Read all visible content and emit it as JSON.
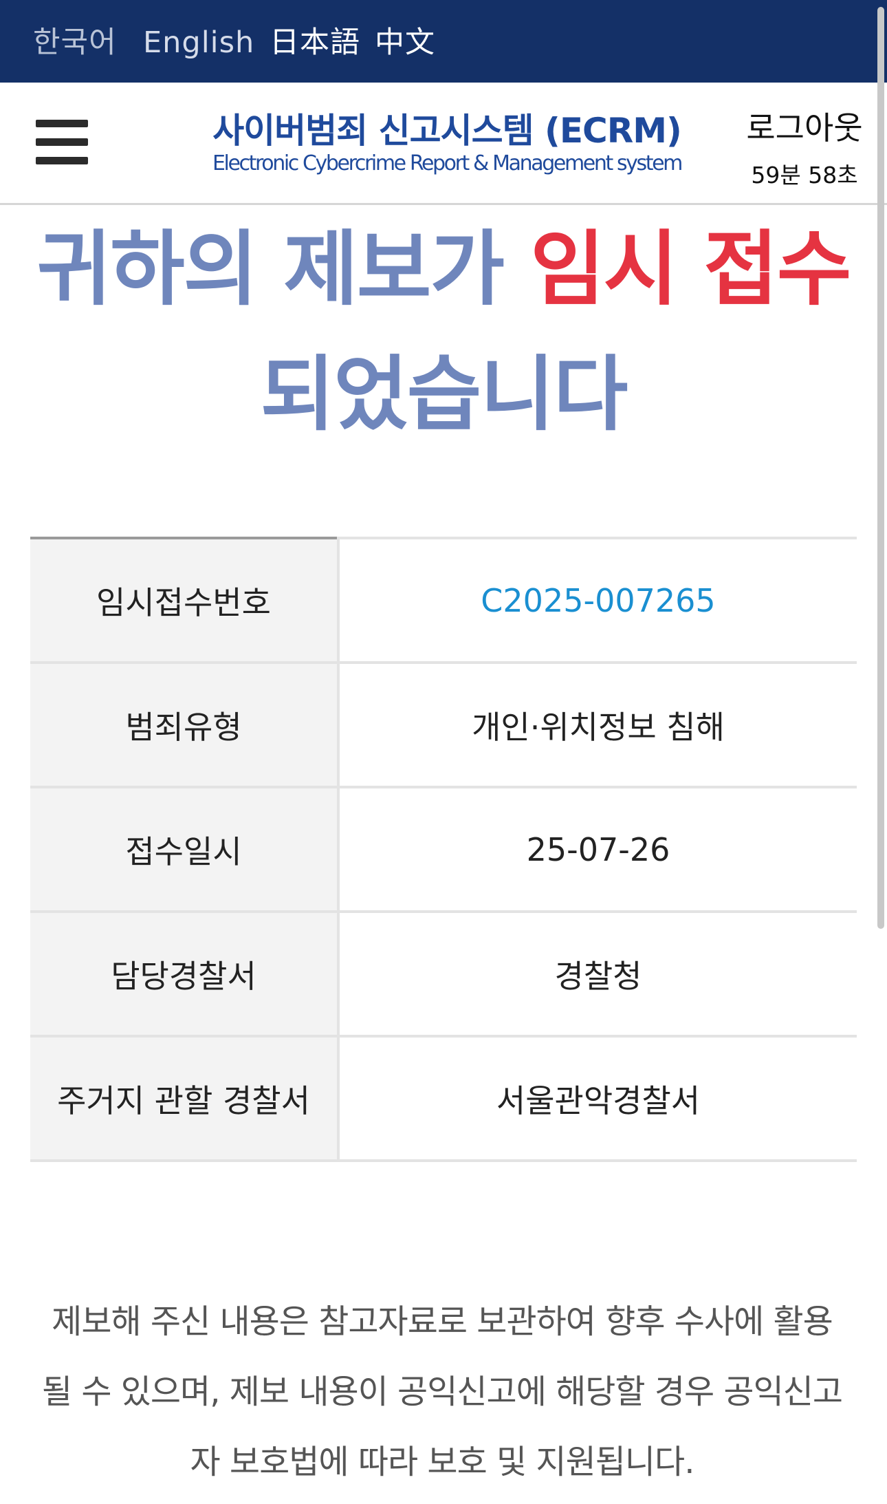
{
  "languages": [
    {
      "label": "한국어",
      "color": "#b9c3d6"
    },
    {
      "label": "English",
      "color": "#d6dcea"
    },
    {
      "label": "日本語",
      "color": "#ffffff"
    },
    {
      "label": "中文",
      "color": "#ffffff"
    }
  ],
  "header": {
    "title": "사이버범죄 신고시스템 (ECRM)",
    "subtitle": "Electronic Cybercrime Report & Management system",
    "logout": "로그아웃",
    "timer": "59분 58초"
  },
  "headline": {
    "part1": "귀하의 제보가 ",
    "accent": "임시 접수",
    "part2": "되었습니다"
  },
  "info_rows": [
    {
      "label": "임시접수번호",
      "value": "C2025-007265"
    },
    {
      "label": "범죄유형",
      "value": "개인·위치정보 침해"
    },
    {
      "label": "접수일시",
      "value": "25-07-26"
    },
    {
      "label": "담당경찰서",
      "value": "경찰청"
    },
    {
      "label": "주거지 관할 경찰서",
      "value": "서울관악경찰서"
    }
  ],
  "notice": {
    "line1": "제보해 주신 내용은 참고자료로 보관하여 향후 수사에 활용",
    "line2": "될 수 있으며, 제보 내용이 공익신고에 해당할 경우 공익신고",
    "line3": "자 보호법에 따라 보호 및 지원됩니다."
  },
  "colors": {
    "langbar": "#143067",
    "brand": "#1f4a9c",
    "headline": "#6f86bc",
    "accent": "#e53341",
    "link": "#1a8fd1"
  }
}
